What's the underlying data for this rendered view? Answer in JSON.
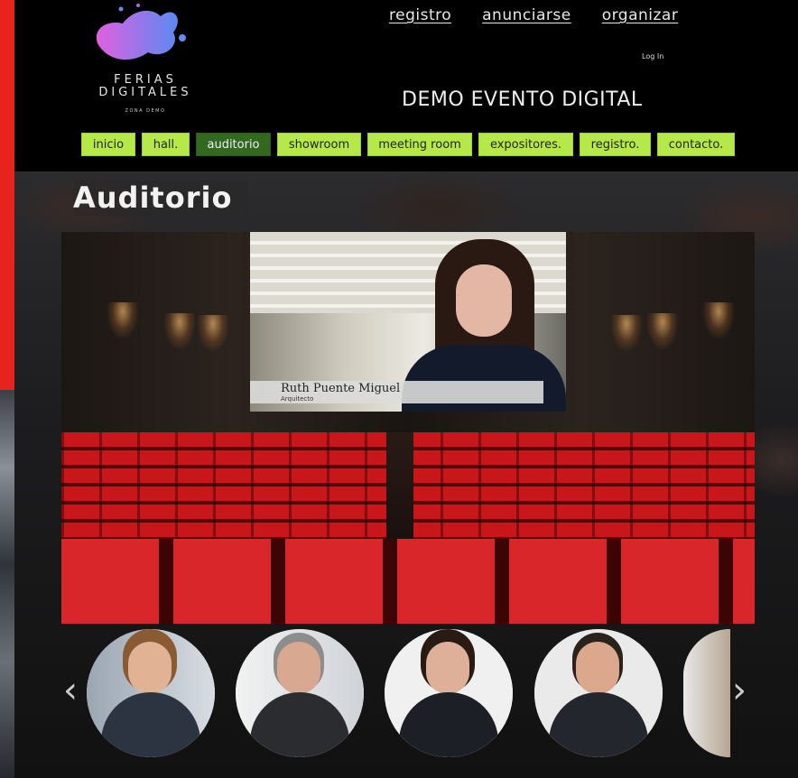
{
  "header": {
    "logo": {
      "line1": "FERIAS",
      "line2": "DIGITALES",
      "sub": "ZONA DEMO"
    },
    "top_links": [
      "registro",
      "anunciarse",
      "organizar"
    ],
    "login_label": "Log In",
    "event_title": "DEMO EVENTO DIGITAL"
  },
  "nav": {
    "items": [
      {
        "label": "inicio",
        "active": false
      },
      {
        "label": "hall.",
        "active": false
      },
      {
        "label": "auditorio",
        "active": true
      },
      {
        "label": "showroom",
        "active": false
      },
      {
        "label": "meeting room",
        "active": false
      },
      {
        "label": "expositores.",
        "active": false
      },
      {
        "label": "registro.",
        "active": false
      },
      {
        "label": "contacto.",
        "active": false
      }
    ]
  },
  "main": {
    "section_title": "Auditorio",
    "video": {
      "name": "Ruth Puente Miguel",
      "role": "Arquitecto"
    }
  },
  "carousel": {
    "prev_icon": "chevron-left-icon",
    "next_icon": "chevron-right-icon",
    "speakers": [
      "speaker-1",
      "speaker-2",
      "speaker-3",
      "speaker-4",
      "speaker-5"
    ]
  },
  "colors": {
    "nav_bg": "#b5e94a",
    "nav_active": "#33691e",
    "accent_red": "#e8231e",
    "seat_red": "#c9161b"
  }
}
